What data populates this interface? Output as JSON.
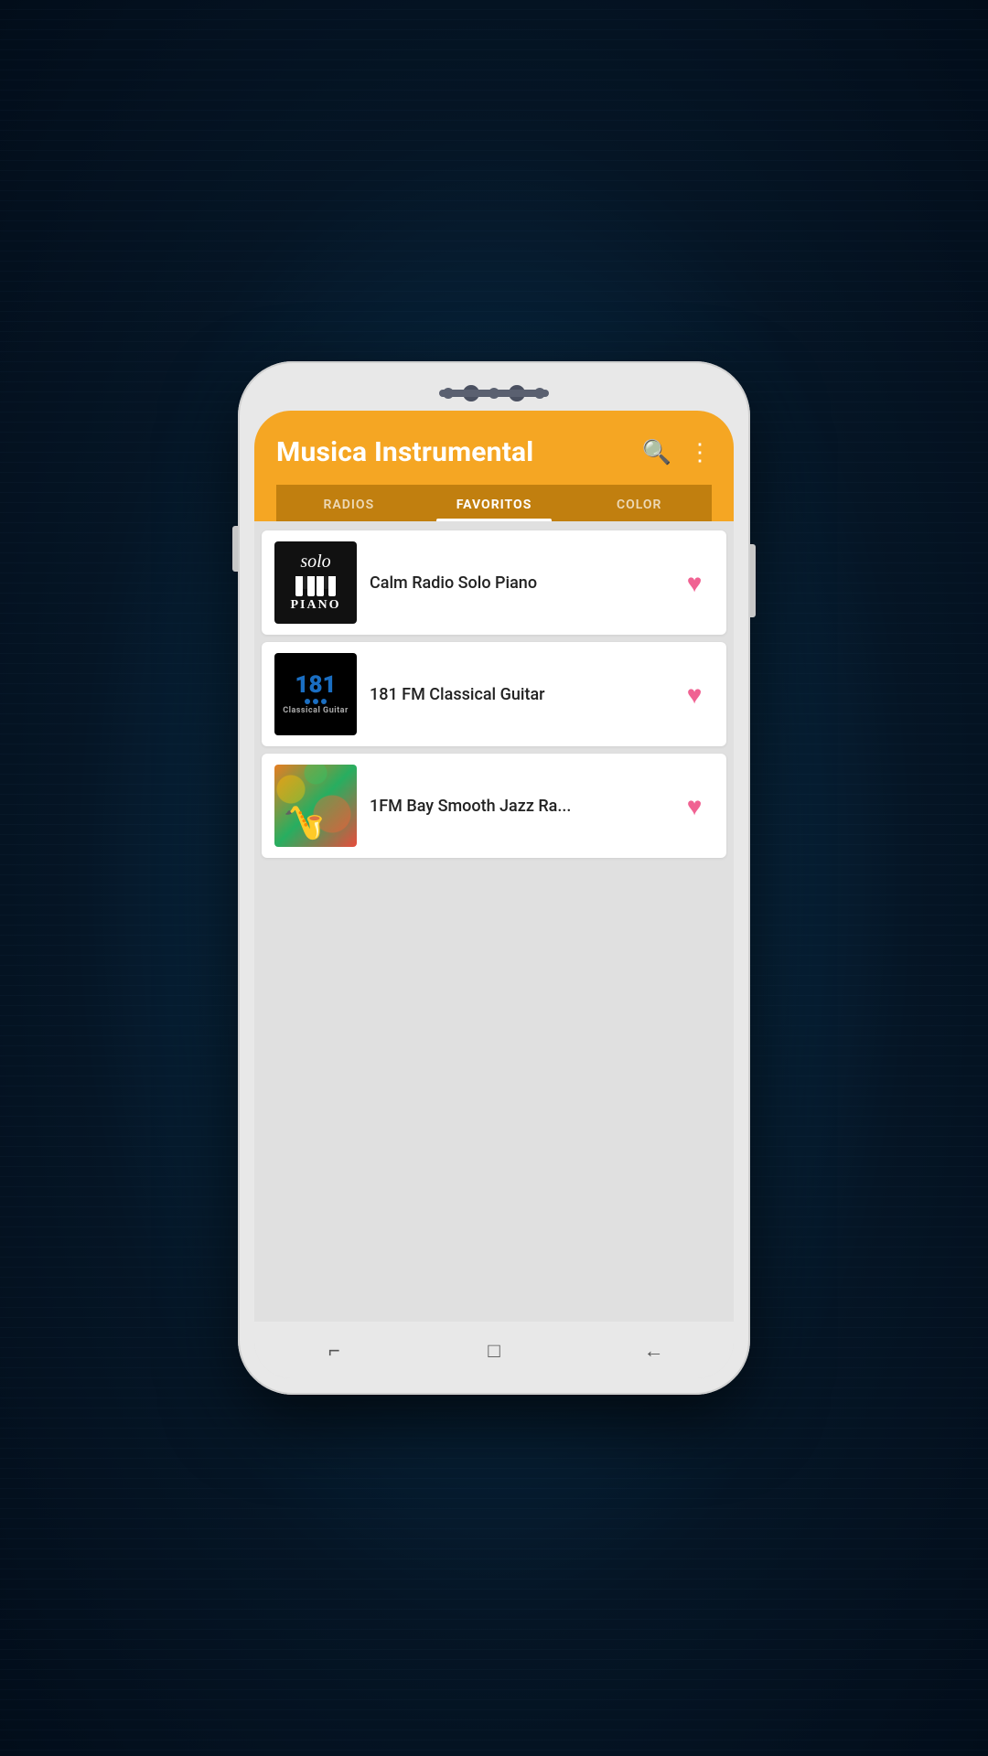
{
  "app": {
    "title": "Musica Instrumental",
    "header_bg": "#F5A623",
    "tab_bg": "#C17F0F"
  },
  "tabs": [
    {
      "id": "radios",
      "label": "RADIOS",
      "active": false
    },
    {
      "id": "favoritos",
      "label": "FAVORITOS",
      "active": true
    },
    {
      "id": "color",
      "label": "COLOR",
      "active": false
    }
  ],
  "favorites": [
    {
      "id": "calm-radio",
      "name": "Calm Radio Solo Piano",
      "thumbnail_type": "solo-piano",
      "favorited": true
    },
    {
      "id": "181fm",
      "name": "181 FM Classical Guitar",
      "thumbnail_type": "181fm",
      "favorited": true
    },
    {
      "id": "1fm-jazz",
      "name": "1FM Bay Smooth Jazz Ra...",
      "thumbnail_type": "jazz",
      "favorited": true
    }
  ],
  "nav": {
    "recents": "⌐",
    "home": "□",
    "back": "←"
  },
  "icons": {
    "search": "🔍",
    "more": "⋮",
    "heart_filled": "♥"
  }
}
